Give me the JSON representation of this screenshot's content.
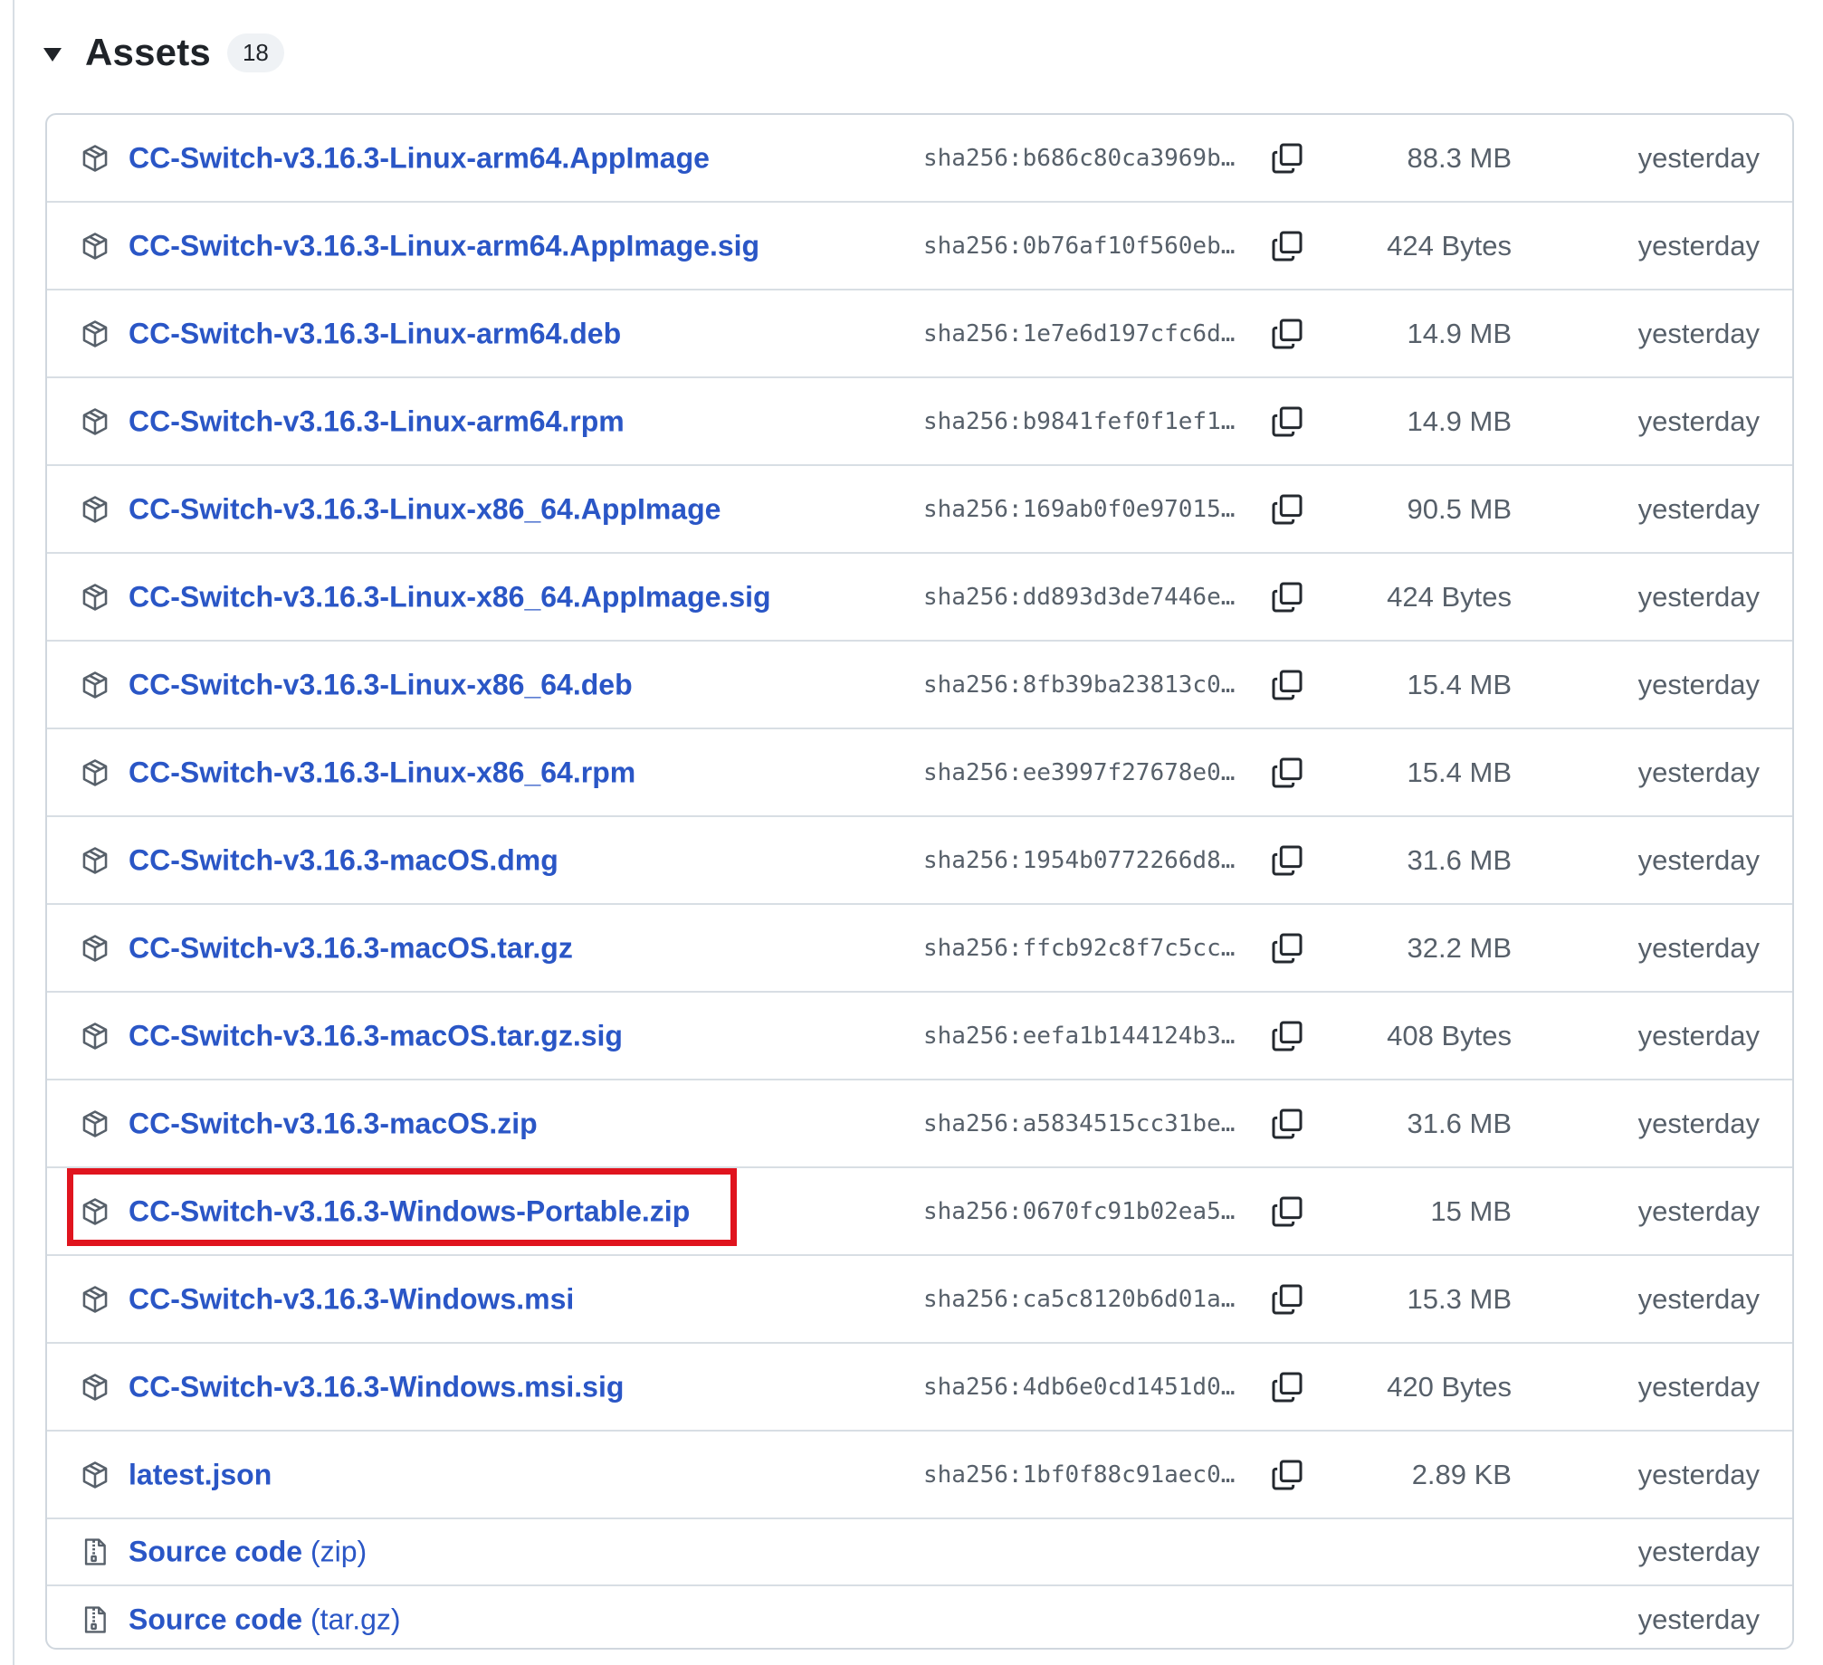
{
  "header": {
    "title": "Assets",
    "count": "18"
  },
  "assets": [
    {
      "name": "CC-Switch-v3.16.3-Linux-arm64.AppImage",
      "sha": "sha256:b686c80ca3969b…",
      "size": "88.3 MB",
      "date": "yesterday"
    },
    {
      "name": "CC-Switch-v3.16.3-Linux-arm64.AppImage.sig",
      "sha": "sha256:0b76af10f560eb…",
      "size": "424 Bytes",
      "date": "yesterday"
    },
    {
      "name": "CC-Switch-v3.16.3-Linux-arm64.deb",
      "sha": "sha256:1e7e6d197cfc6d…",
      "size": "14.9 MB",
      "date": "yesterday"
    },
    {
      "name": "CC-Switch-v3.16.3-Linux-arm64.rpm",
      "sha": "sha256:b9841fef0f1ef1…",
      "size": "14.9 MB",
      "date": "yesterday"
    },
    {
      "name": "CC-Switch-v3.16.3-Linux-x86_64.AppImage",
      "sha": "sha256:169ab0f0e97015…",
      "size": "90.5 MB",
      "date": "yesterday"
    },
    {
      "name": "CC-Switch-v3.16.3-Linux-x86_64.AppImage.sig",
      "sha": "sha256:dd893d3de7446e…",
      "size": "424 Bytes",
      "date": "yesterday"
    },
    {
      "name": "CC-Switch-v3.16.3-Linux-x86_64.deb",
      "sha": "sha256:8fb39ba23813c0…",
      "size": "15.4 MB",
      "date": "yesterday"
    },
    {
      "name": "CC-Switch-v3.16.3-Linux-x86_64.rpm",
      "sha": "sha256:ee3997f27678e0…",
      "size": "15.4 MB",
      "date": "yesterday"
    },
    {
      "name": "CC-Switch-v3.16.3-macOS.dmg",
      "sha": "sha256:1954b0772266d8…",
      "size": "31.6 MB",
      "date": "yesterday"
    },
    {
      "name": "CC-Switch-v3.16.3-macOS.tar.gz",
      "sha": "sha256:ffcb92c8f7c5cc…",
      "size": "32.2 MB",
      "date": "yesterday"
    },
    {
      "name": "CC-Switch-v3.16.3-macOS.tar.gz.sig",
      "sha": "sha256:eefa1b144124b3…",
      "size": "408 Bytes",
      "date": "yesterday"
    },
    {
      "name": "CC-Switch-v3.16.3-macOS.zip",
      "sha": "sha256:a5834515cc31be…",
      "size": "31.6 MB",
      "date": "yesterday"
    },
    {
      "name": "CC-Switch-v3.16.3-Windows-Portable.zip",
      "sha": "sha256:0670fc91b02ea5…",
      "size": "15 MB",
      "date": "yesterday"
    },
    {
      "name": "CC-Switch-v3.16.3-Windows.msi",
      "sha": "sha256:ca5c8120b6d01a…",
      "size": "15.3 MB",
      "date": "yesterday"
    },
    {
      "name": "CC-Switch-v3.16.3-Windows.msi.sig",
      "sha": "sha256:4db6e0cd1451d0…",
      "size": "420 Bytes",
      "date": "yesterday"
    },
    {
      "name": "latest.json",
      "sha": "sha256:1bf0f88c91aec0…",
      "size": "2.89 KB",
      "date": "yesterday"
    }
  ],
  "source": [
    {
      "label": "Source code",
      "format": "(zip)",
      "date": "yesterday"
    },
    {
      "label": "Source code",
      "format": "(tar.gz)",
      "date": "yesterday"
    }
  ],
  "icons": {
    "asset": "package-icon",
    "source": "file-zip-icon",
    "copy": "copy-icon",
    "toggle": "triangle-down-icon"
  },
  "colors": {
    "link": "#2a56c6",
    "highlight": "#e0141e",
    "muted": "#57606a"
  }
}
